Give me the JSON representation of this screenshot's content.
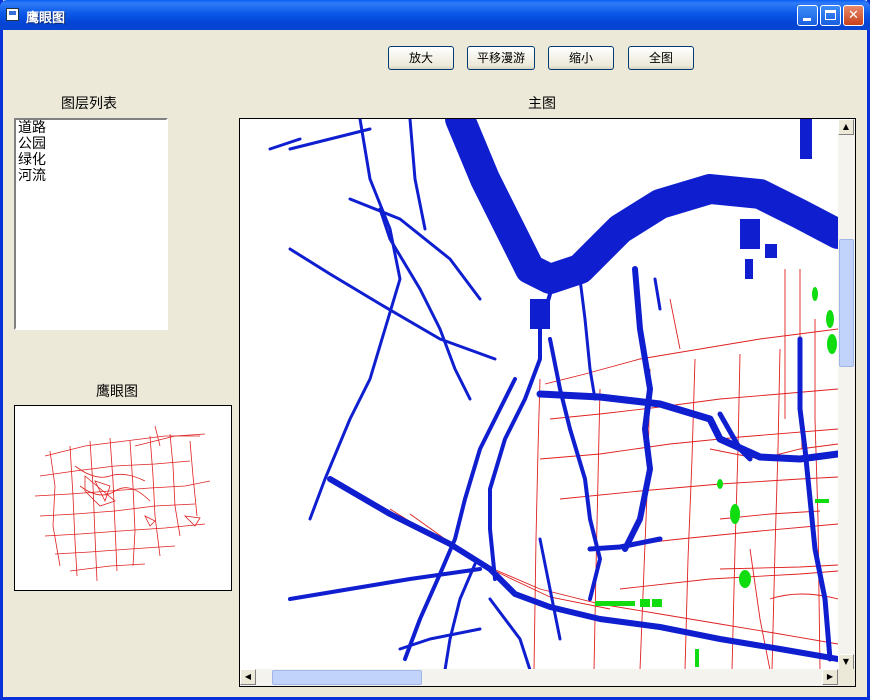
{
  "window": {
    "title": "鹰眼图"
  },
  "toolbar": {
    "zoom_in": "放大",
    "pan": "平移漫游",
    "zoom_out": "缩小",
    "full_extent": "全图"
  },
  "layers": {
    "heading": "图层列表",
    "items": [
      "道路",
      "公园",
      "绿化",
      "河流"
    ]
  },
  "main_map": {
    "heading": "主图"
  },
  "eagle_eye": {
    "heading": "鹰眼图"
  },
  "colors": {
    "river": "#0f1fd0",
    "road": "#e02020",
    "green": "#10dc10"
  }
}
